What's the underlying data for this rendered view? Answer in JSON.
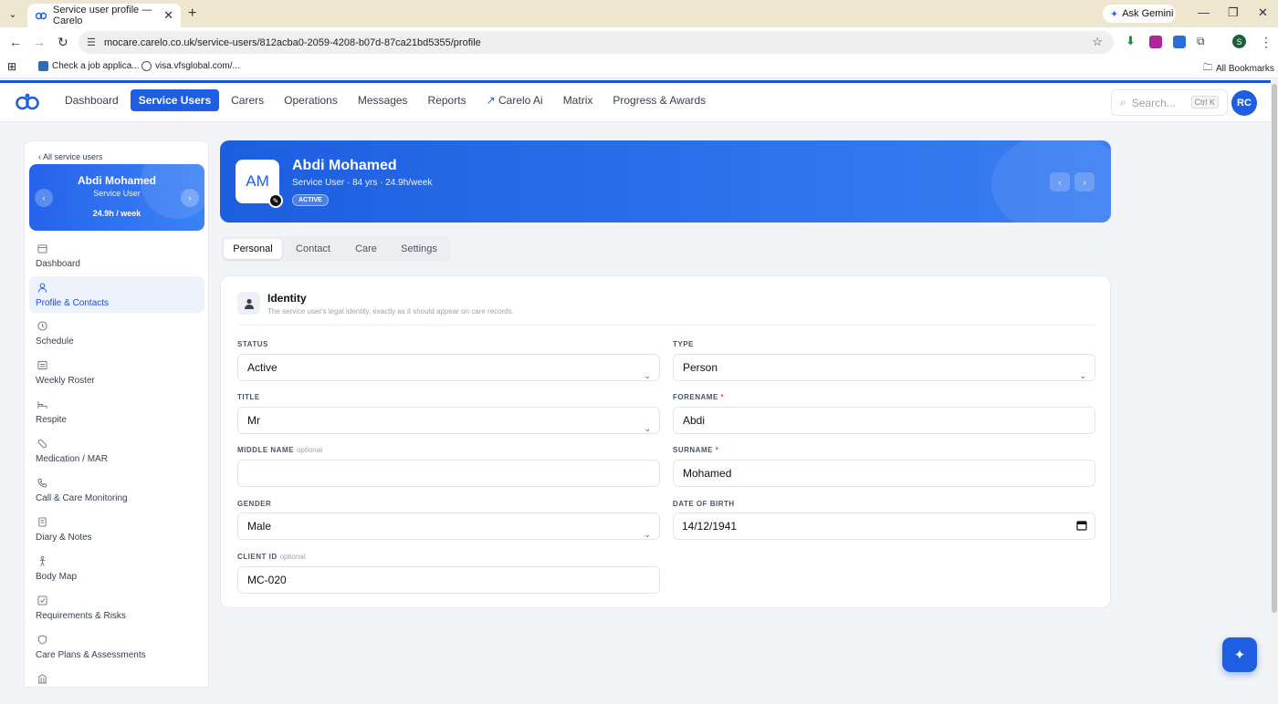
{
  "browser": {
    "tab_title": "Service user profile — Carelo",
    "url": "mocare.carelo.co.uk/service-users/812acba0-2059-4208-b07d-87ca21bd5355/profile",
    "ask_gemini": "Ask Gemini",
    "profile_initial": "S",
    "bookmarks": [
      {
        "label": "Check a job applica..."
      },
      {
        "label": "visa.vfsglobal.com/..."
      }
    ],
    "all_bookmarks": "All Bookmarks"
  },
  "app": {
    "nav": [
      "Dashboard",
      "Service Users",
      "Carers",
      "Operations",
      "Messages",
      "Reports",
      "Carelo Ai",
      "Matrix",
      "Progress & Awards"
    ],
    "active_nav": "Service Users",
    "search_placeholder": "Search...",
    "search_kbd": "Ctrl K",
    "user_initials": "RC",
    "accent": "#1d5fe0"
  },
  "sidebar": {
    "back_link": "‹ All service users",
    "card": {
      "name": "Abdi Mohamed",
      "role": "Service User",
      "hours": "24.9h / week"
    },
    "items": [
      {
        "label": "Dashboard",
        "icon": "calendar-icon"
      },
      {
        "label": "Profile & Contacts",
        "icon": "person-icon",
        "active": true
      },
      {
        "label": "Schedule",
        "icon": "clock-icon"
      },
      {
        "label": "Weekly Roster",
        "icon": "roster-icon"
      },
      {
        "label": "Respite",
        "icon": "bed-icon"
      },
      {
        "label": "Medication / MAR",
        "icon": "pill-icon"
      },
      {
        "label": "Call & Care Monitoring",
        "icon": "phone-icon"
      },
      {
        "label": "Diary & Notes",
        "icon": "notes-icon"
      },
      {
        "label": "Body Map",
        "icon": "body-icon"
      },
      {
        "label": "Requirements & Risks",
        "icon": "checkbox-icon"
      },
      {
        "label": "Care Plans & Assessments",
        "icon": "shield-icon"
      },
      {
        "label": "",
        "icon": "building-icon"
      }
    ]
  },
  "hero": {
    "initials": "AM",
    "name": "Abdi Mohamed",
    "subtitle": "Service User · 84 yrs · 24.9h/week",
    "status_badge": "ACTIVE"
  },
  "tabs": [
    "Personal",
    "Contact",
    "Care",
    "Settings"
  ],
  "active_tab": "Personal",
  "identity": {
    "title": "Identity",
    "description": "The service user's legal identity, exactly as it should appear on care records.",
    "fields": {
      "status": {
        "label": "STATUS",
        "value": "Active"
      },
      "type": {
        "label": "TYPE",
        "value": "Person"
      },
      "title": {
        "label": "TITLE",
        "value": "Mr"
      },
      "forename": {
        "label": "FORENAME",
        "value": "Abdi",
        "required": "*"
      },
      "middle_name": {
        "label": "MIDDLE NAME",
        "optional": "optional",
        "value": ""
      },
      "surname": {
        "label": "SURNAME",
        "value": "Mohamed",
        "required": "*"
      },
      "gender": {
        "label": "GENDER",
        "value": "Male"
      },
      "dob": {
        "label": "DATE OF BIRTH",
        "value": "14/12/1941"
      },
      "client_id": {
        "label": "CLIENT ID",
        "optional": "optional",
        "value": "MC-020"
      }
    }
  }
}
